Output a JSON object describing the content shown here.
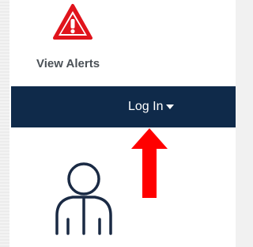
{
  "alerts": {
    "label": "View Alerts",
    "icon": "warning-triangle-icon",
    "icon_color": "#e0141c"
  },
  "navbar": {
    "background": "#0f2a4a",
    "login_label": "Log In",
    "caret_icon": "caret-down-icon"
  },
  "user_icon": "user-outline-icon",
  "annotation": {
    "icon": "red-arrow-icon",
    "color": "#ff0000"
  }
}
